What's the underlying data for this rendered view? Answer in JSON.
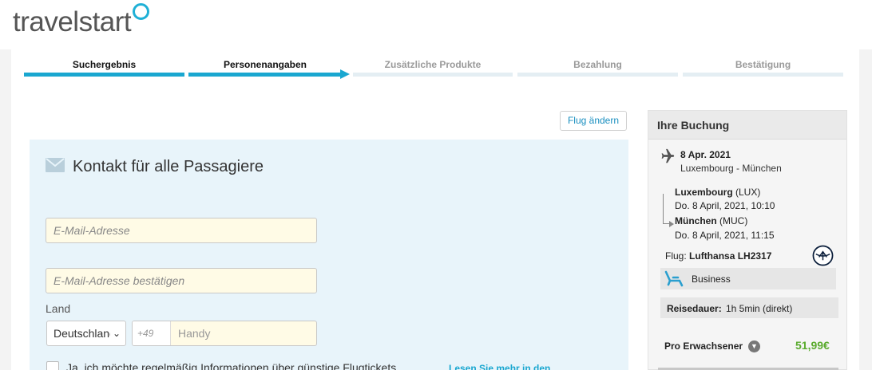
{
  "brand": {
    "name": "travelstart",
    "ring_color": "#1fb0d6"
  },
  "steps": [
    {
      "label": "Suchergebnis",
      "state": "done"
    },
    {
      "label": "Personenangaben",
      "state": "current"
    },
    {
      "label": "Zusätzliche Produkte",
      "state": "todo"
    },
    {
      "label": "Bezahlung",
      "state": "todo"
    },
    {
      "label": "Bestätigung",
      "state": "todo"
    }
  ],
  "actions": {
    "change_flight": "Flug ändern"
  },
  "contact": {
    "title": "Kontakt für alle Passagiere",
    "email_placeholder": "E-Mail-Adresse",
    "email_confirm_placeholder": "E-Mail-Adresse bestätigen",
    "country_label": "Land",
    "country_value": "Deutschland",
    "phone_prefix": "+49",
    "phone_placeholder": "Handy",
    "newsletter_text": "Ja, ich möchte regelmäßig Informationen über günstige Flugtickets",
    "more_link": "Lesen Sie mehr in den"
  },
  "booking": {
    "title": "Ihre Buchung",
    "date": "8 Apr. 2021",
    "route": "Luxembourg - München",
    "departure_city": "Luxembourg",
    "departure_code": "(LUX)",
    "departure_time": "Do. 8 April, 2021, 10:10",
    "arrival_city": "München",
    "arrival_code": "(MUC)",
    "arrival_time": "Do. 8 April, 2021, 11:15",
    "flight_label": "Flug:",
    "flight_value": "Lufthansa LH2317",
    "cabin": "Business",
    "duration_label": "Reisedauer:",
    "duration_value": "1h 5min (direkt)",
    "price_label": "Pro Erwachsener",
    "price_value": "51,99€",
    "price_color": "#5aab2e"
  },
  "icons": [
    "envelope-icon",
    "plane-icon",
    "lufthansa-logo-icon",
    "seat-icon",
    "chevron-down-icon"
  ]
}
